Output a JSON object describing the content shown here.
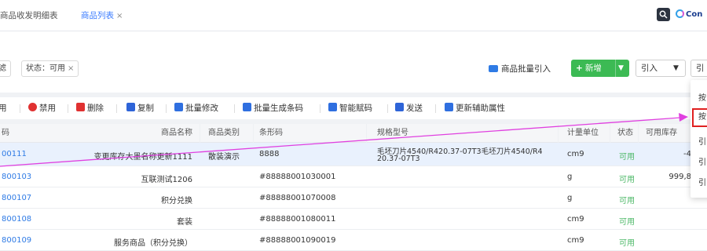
{
  "tabs": [
    {
      "label": "商品收发明细表",
      "active": false
    },
    {
      "label": "商品列表",
      "active": true,
      "close": "×"
    }
  ],
  "brand": {
    "logo_text": "Con",
    "icon": "ring-logo-icon"
  },
  "filters": {
    "chip0": "滤",
    "chip1": {
      "label": "状态：可用",
      "close": "×"
    }
  },
  "actions": {
    "batch_import": "商品批量引入",
    "add": "新增",
    "add_icon": "plus-icon",
    "import": "引入",
    "more": "引"
  },
  "toolbar": {
    "items": [
      {
        "label": "用",
        "icon": "enable-icon"
      },
      {
        "label": "禁用",
        "icon": "ban-icon"
      },
      {
        "label": "删除",
        "icon": "trash-icon"
      },
      {
        "label": "复制",
        "icon": "copy-icon"
      },
      {
        "label": "批量修改",
        "icon": "checkbox-icon"
      },
      {
        "label": "批量生成条码",
        "icon": "checkbox-icon"
      },
      {
        "label": "智能赋码",
        "icon": "checkbox-icon"
      },
      {
        "label": "发送",
        "icon": "upload-icon"
      },
      {
        "label": "更新辅助属性",
        "icon": "checkbox-icon"
      }
    ]
  },
  "table": {
    "columns": [
      "码",
      "商品名称",
      "商品类别",
      "条形码",
      "规格型号",
      "计量单位",
      "状态",
      "可用库存"
    ],
    "rows": [
      {
        "code": "00111",
        "name": "变更库存大墨名称更新1111",
        "category": "散装演示",
        "barcode": "8888",
        "spec1": "毛坯刀片4540/R420.37-07T3毛坯刀片4540/R4",
        "spec2": "20.37-07T3",
        "unit": "cm9",
        "status": "可用",
        "stock": "-4"
      },
      {
        "code": "800103",
        "name": "互联测试1206",
        "category": "",
        "barcode": "#88888001030001",
        "spec1": "",
        "spec2": "",
        "unit": "g",
        "status": "可用",
        "stock": "999,8"
      },
      {
        "code": "800107",
        "name": "积分兑换",
        "category": "",
        "barcode": "#88888001070008",
        "spec1": "",
        "spec2": "",
        "unit": "g",
        "status": "可用",
        "stock": ""
      },
      {
        "code": "800108",
        "name": "套装",
        "category": "",
        "barcode": "#88888001080011",
        "spec1": "",
        "spec2": "",
        "unit": "cm9",
        "status": "可用",
        "stock": ""
      },
      {
        "code": "800109",
        "name": "服务商品（积分兑换）",
        "category": "",
        "barcode": "#88888001090019",
        "spec1": "",
        "spec2": "",
        "unit": "cm9",
        "status": "可用",
        "stock": ""
      }
    ]
  },
  "dropdown": {
    "items": [
      "按",
      "按",
      "引",
      "引",
      "引"
    ],
    "highlighted_index": 1
  },
  "colors": {
    "accent": "#2f7be5",
    "add_green": "#3cba54",
    "status_green": "#4cb867",
    "annotation": "#e040e0",
    "highlight_red": "#e02020"
  }
}
